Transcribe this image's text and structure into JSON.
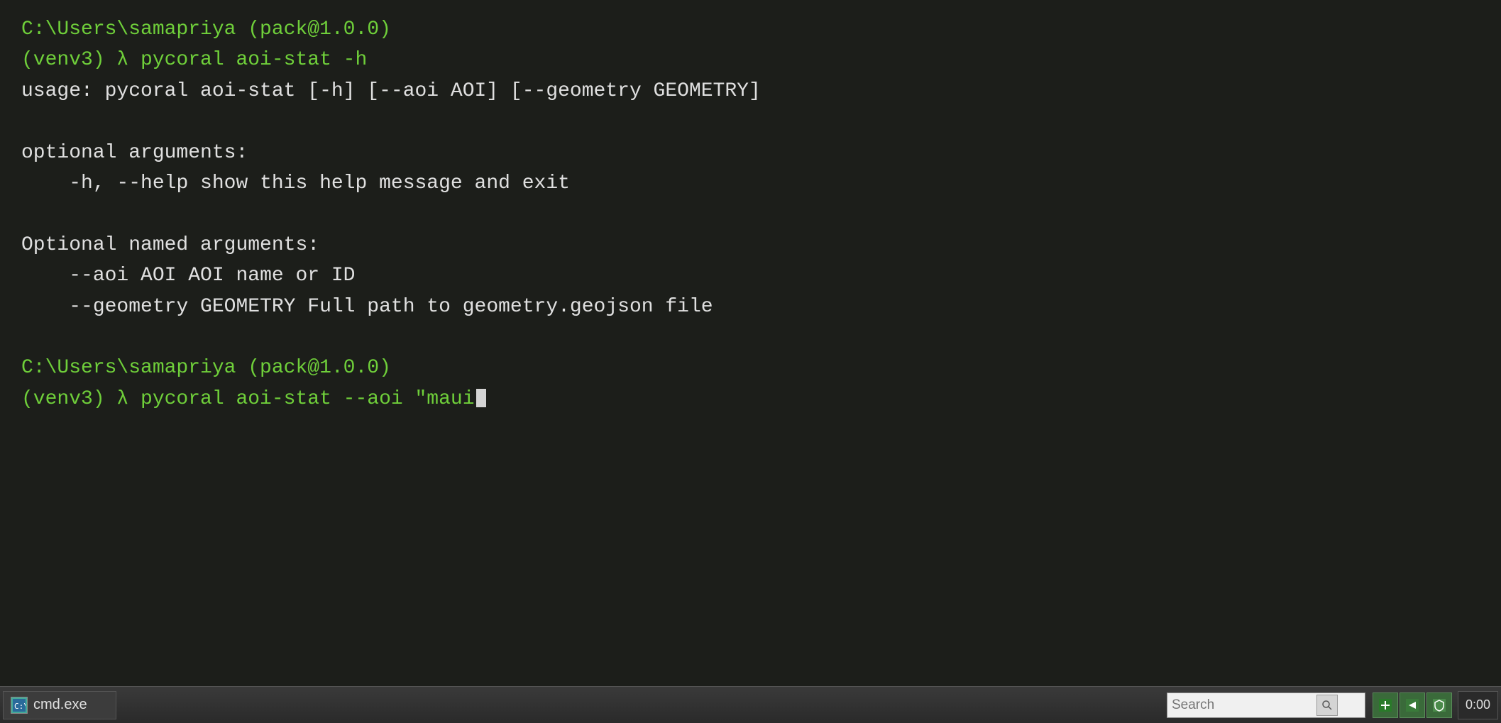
{
  "terminal": {
    "background_color": "#1c1e1a",
    "lines": [
      {
        "type": "green",
        "text": "C:\\Users\\samapriya   (pack@1.0.0)"
      },
      {
        "type": "green",
        "text": "(venv3) λ pycoral aoi-stat -h"
      },
      {
        "type": "white",
        "text": "usage: pycoral aoi-stat [-h] [--aoi AOI] [--geometry GEOMETRY]"
      },
      {
        "type": "blank"
      },
      {
        "type": "white",
        "text": "optional arguments:"
      },
      {
        "type": "white_indent",
        "text": "-h, --help              show this help message and exit"
      },
      {
        "type": "blank"
      },
      {
        "type": "white",
        "text": "Optional named arguments:"
      },
      {
        "type": "white_indent",
        "text": "--aoi AOI               AOI name or ID"
      },
      {
        "type": "white_indent",
        "text": "--geometry GEOMETRY   Full path to geometry.geojson file"
      },
      {
        "type": "blank"
      },
      {
        "type": "green",
        "text": "C:\\Users\\samapriya   (pack@1.0.0)"
      },
      {
        "type": "green_cursor",
        "text": "(venv3) λ pycoral aoi-stat --aoi \"maui"
      }
    ]
  },
  "taskbar": {
    "app_label": "cmd.exe",
    "search_placeholder": "Search",
    "search_value": "",
    "clock": "0:00"
  }
}
